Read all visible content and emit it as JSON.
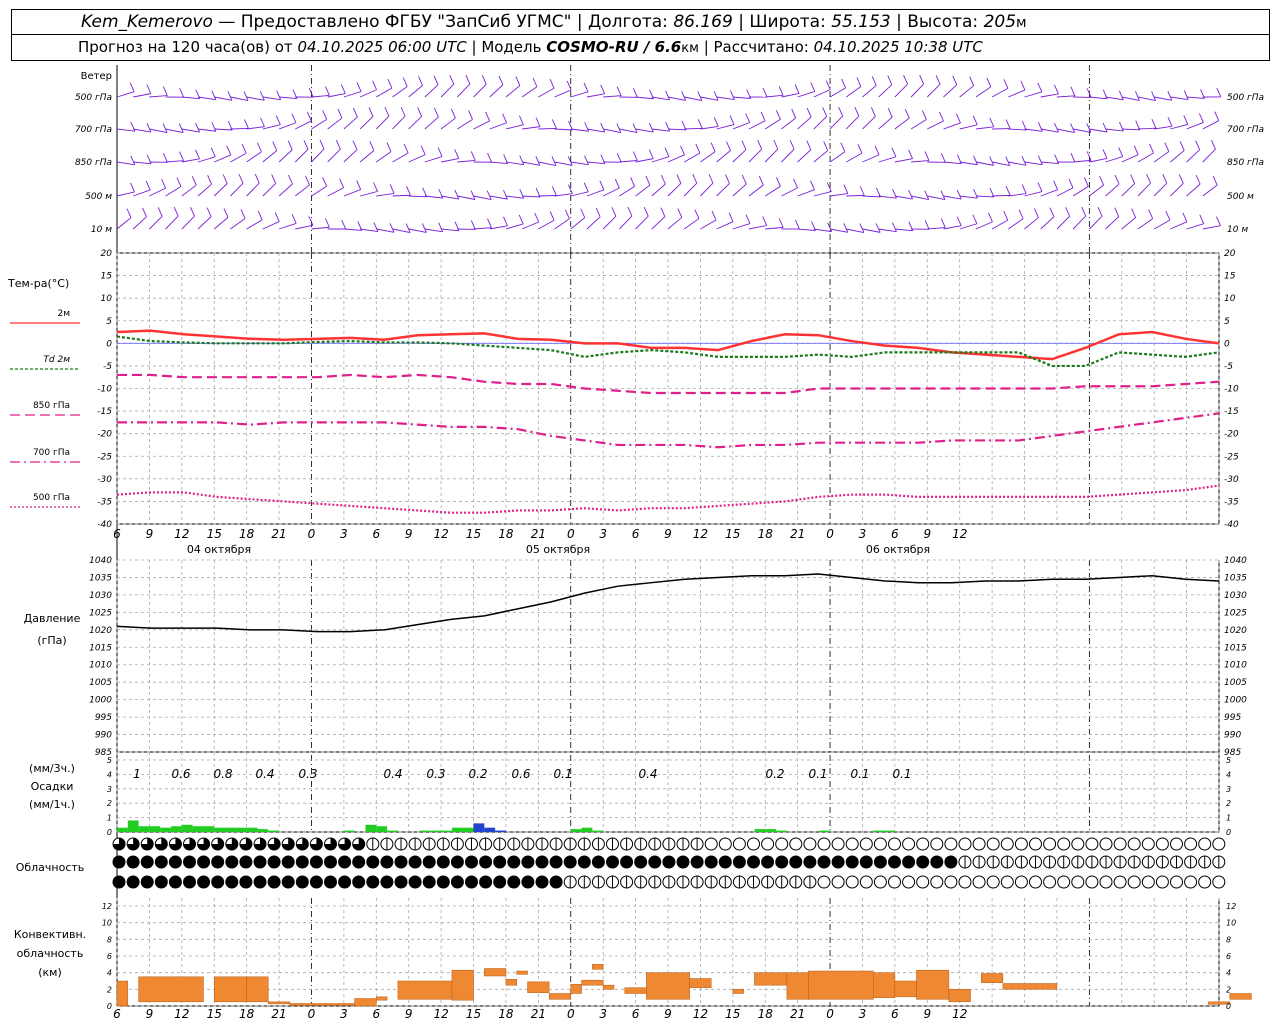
{
  "header": {
    "station": "Kem_Kemerovo",
    "dash": "—",
    "provider": "Предоставлено ФГБУ \"ЗапСиб УГМС\"",
    "lon_label": "Долгота:",
    "lon_value": "86.169",
    "lat_label": "Широта:",
    "lat_value": "55.153",
    "alt_label": "Высота:",
    "alt_value": "205",
    "alt_unit": "м",
    "forecast_label": "Прогноз на 120 часа(ов)  от",
    "start_time": "04.10.2025 06:00 UTC",
    "model_label": "Модель",
    "model_name": "COSMO-RU / 6.6",
    "model_unit": "км",
    "computed_label": "Рассчитано:",
    "computed_time": "04.10.2025 10:38 UTC"
  },
  "wind_panel": {
    "title": "Ветер",
    "levels": [
      "500 гПа",
      "700 гПа",
      "850 гПа",
      "500 м",
      "10  м"
    ]
  },
  "temp_panel": {
    "title": "Тем-ра(°C)",
    "legend": [
      "2м",
      "Td  2м",
      "850 гПа",
      "700 гПа",
      "500 гПа"
    ],
    "yticks": [
      20,
      15,
      10,
      5,
      0,
      -5,
      -10,
      -15,
      -20,
      -25,
      -30,
      -35,
      -40
    ]
  },
  "pressure_panel": {
    "title": "Давление",
    "unit": "(гПа)",
    "yticks": [
      1040,
      1035,
      1030,
      1025,
      1020,
      1015,
      1010,
      1005,
      1000,
      995,
      990,
      985
    ]
  },
  "precip_panel": {
    "unit3h": "(мм/3ч.)",
    "title": "Осадки",
    "unit1h": "(мм/1ч.)",
    "yticks": [
      5,
      4,
      3,
      2,
      1,
      0
    ],
    "labels": [
      "1",
      "0.6",
      "0.8",
      "0.4",
      "0.3",
      "0.4",
      "0.3",
      "0.2",
      "0.6",
      "0.1",
      "0.4",
      "0.2",
      "0.1",
      "0.1",
      "0.1"
    ]
  },
  "cloud_panel": {
    "title": "Облачность"
  },
  "conv_panel": {
    "title1": "Конвективн.",
    "title2": "облачность",
    "unit": "(км)",
    "yticks": [
      12,
      10,
      8,
      6,
      4,
      2,
      0
    ]
  },
  "time_axis": {
    "hours": [
      "6",
      "9",
      "12",
      "15",
      "18",
      "21",
      "0",
      "3",
      "6",
      "9",
      "12",
      "15",
      "18",
      "21",
      "0",
      "3",
      "6",
      "9",
      "12",
      "15",
      "18",
      "21",
      "0",
      "3",
      "6",
      "9",
      "12"
    ],
    "dates": [
      "04 октября",
      "05 октября",
      "06 октября"
    ]
  },
  "colors": {
    "wind": "#7a1fd8",
    "t2m": "#ff3333",
    "td2m": "#1a7a1a",
    "t850": "#e0208a",
    "t700": "#e0208a",
    "t500": "#e0208a",
    "pressure": "#000000",
    "precip_rain": "#22cc22",
    "precip_heavy": "#2244cc",
    "convective": "#ee8833"
  },
  "chart_data": {
    "type": "line",
    "x_hours_from_start": [
      0,
      3,
      6,
      9,
      12,
      15,
      18,
      21,
      24,
      27,
      30,
      33,
      36,
      39,
      42,
      45,
      48,
      51,
      54,
      57,
      60,
      63,
      66,
      69,
      72,
      75,
      78
    ],
    "temperature": {
      "ylim": [
        -40,
        20
      ],
      "series": [
        {
          "name": "2м",
          "values": [
            2.5,
            2.8,
            2,
            1.5,
            1,
            0.8,
            1,
            1.2,
            0.8,
            1.8,
            2,
            2.2,
            1,
            0.8,
            0,
            0,
            -1,
            -1,
            -1.5,
            0.5,
            2,
            1.8,
            0.5,
            -0.5,
            -1,
            -2,
            -2.5,
            -3,
            -3.5,
            -1,
            2,
            2.5,
            1,
            0
          ]
        },
        {
          "name": "Td  2м",
          "values": [
            1.5,
            0.5,
            0.2,
            0,
            0,
            0,
            0.3,
            0.5,
            0.2,
            0.2,
            0,
            -0.5,
            -1,
            -1.5,
            -3,
            -2,
            -1.5,
            -2,
            -3,
            -3,
            -3,
            -2.5,
            -3,
            -2,
            -2,
            -2,
            -2,
            -2,
            -5,
            -5,
            -2,
            -2.5,
            -3,
            -2
          ]
        },
        {
          "name": "850 гПа",
          "values": [
            -7,
            -7,
            -7.5,
            -7.5,
            -7.5,
            -7.5,
            -7.5,
            -7,
            -7.5,
            -7,
            -7.5,
            -8.5,
            -9,
            -9,
            -10,
            -10.5,
            -11,
            -11,
            -11,
            -11,
            -11,
            -10,
            -10,
            -10,
            -10,
            -10,
            -10,
            -10,
            -10,
            -9.5,
            -9.5,
            -9.5,
            -9,
            -8.5
          ]
        },
        {
          "name": "700 гПа",
          "values": [
            -17.5,
            -17.5,
            -17.5,
            -17.5,
            -18,
            -17.5,
            -17.5,
            -17.5,
            -17.5,
            -18,
            -18.5,
            -18.5,
            -19,
            -20.5,
            -21.5,
            -22.5,
            -22.5,
            -22.5,
            -23,
            -22.5,
            -22.5,
            -22,
            -22,
            -22,
            -22,
            -21.5,
            -21.5,
            -21.5,
            -20.5,
            -19.5,
            -18.5,
            -17.5,
            -16.5,
            -15.5
          ]
        },
        {
          "name": "500 гПа",
          "values": [
            -33.5,
            -33,
            -33,
            -34,
            -34.5,
            -35,
            -35.5,
            -36,
            -36.5,
            -37,
            -37.5,
            -37.5,
            -37,
            -37,
            -36.5,
            -37,
            -36.5,
            -36.5,
            -36,
            -35.5,
            -35,
            -34,
            -33.5,
            -33.5,
            -34,
            -34,
            -34,
            -34,
            -34,
            -34,
            -33.5,
            -33,
            -32.5,
            -31.5
          ]
        }
      ]
    },
    "pressure": {
      "ylim": [
        985,
        1040
      ],
      "values": [
        1021,
        1020.5,
        1020.5,
        1020.5,
        1020,
        1020,
        1019.5,
        1019.5,
        1020,
        1021.5,
        1023,
        1024,
        1026,
        1028,
        1030.5,
        1032.5,
        1033.5,
        1034.5,
        1035,
        1035.5,
        1035.5,
        1036,
        1035,
        1034,
        1033.5,
        1033.5,
        1034,
        1034,
        1034.5,
        1034.5,
        1035,
        1035.5,
        1034.5,
        1034
      ]
    },
    "precipitation": {
      "ylim": [
        0,
        5
      ],
      "hourly_mm": [
        0.3,
        0.8,
        0.4,
        0.4,
        0.3,
        0.4,
        0.5,
        0.4,
        0.4,
        0.3,
        0.3,
        0.3,
        0.3,
        0.2,
        0.1,
        0,
        0,
        0,
        0,
        0,
        0,
        0.1,
        0,
        0.5,
        0.4,
        0.1,
        0,
        0,
        0.1,
        0.1,
        0.1,
        0.3,
        0.3,
        0.6,
        0.3,
        0.1,
        0,
        0,
        0,
        0,
        0,
        0,
        0.2,
        0.3,
        0.1,
        0,
        0,
        0,
        0,
        0,
        0,
        0,
        0,
        0,
        0,
        0,
        0,
        0,
        0,
        0.2,
        0.2,
        0.1,
        0,
        0,
        0,
        0.1,
        0,
        0,
        0,
        0,
        0.1,
        0.1,
        0,
        0,
        0,
        0,
        0,
        0,
        0,
        0,
        0,
        0,
        0,
        0,
        0,
        0,
        0,
        0,
        0,
        0,
        0,
        0,
        0,
        0,
        0,
        0,
        0,
        0,
        0,
        0,
        0,
        0,
        0,
        0,
        0,
        0,
        0,
        0,
        0,
        0,
        0,
        0,
        0,
        0,
        0,
        0,
        0,
        0
      ],
      "three_hour_mm": [
        1,
        0.6,
        0.8,
        0.4,
        0.3,
        0.4,
        0.3,
        0.2,
        0.6,
        0.1,
        0.4,
        0.2,
        0.1,
        0.1,
        0.1
      ]
    },
    "convective_cloud_km": {
      "ylim": [
        0,
        12
      ],
      "segments_hours": [
        [
          0,
          1,
          3
        ],
        [
          2,
          8,
          0.5,
          3.5
        ],
        [
          9,
          12,
          0.5,
          3.5
        ],
        [
          12,
          14,
          0.5,
          3.5
        ],
        [
          14,
          16,
          0.3,
          0.5
        ],
        [
          16,
          22,
          0.2,
          0.3
        ],
        [
          22,
          24,
          0,
          0.9
        ],
        [
          24,
          25,
          0.7,
          1.1
        ],
        [
          26,
          31,
          0.8,
          3
        ],
        [
          31,
          33,
          0.7,
          4.3
        ],
        [
          34,
          36,
          3.6,
          4.5
        ],
        [
          36,
          37,
          2.5,
          3.2
        ],
        [
          37,
          38,
          3.8,
          4.2
        ],
        [
          38,
          40,
          1.6,
          2.9
        ],
        [
          40,
          42,
          0.8,
          1.5
        ],
        [
          42,
          43,
          1.5,
          2.6
        ],
        [
          43,
          45,
          2.5,
          3.1
        ],
        [
          44,
          45,
          4.4,
          5
        ],
        [
          45,
          46,
          2,
          2.5
        ],
        [
          47,
          49,
          1.5,
          2.2
        ],
        [
          49,
          53,
          0.8,
          4
        ],
        [
          53,
          55,
          2.2,
          3.3
        ],
        [
          57,
          58,
          1.5,
          2
        ],
        [
          59,
          62,
          2.5,
          4
        ],
        [
          62,
          64,
          0.8,
          4
        ],
        [
          64,
          70,
          0.8,
          4.2
        ],
        [
          70,
          72,
          1,
          4
        ],
        [
          72,
          74,
          1.1,
          3
        ],
        [
          74,
          77,
          0.8,
          4.3
        ],
        [
          77,
          79,
          0.5,
          2
        ],
        [
          80,
          82,
          2.8,
          3.9
        ],
        [
          82,
          87,
          2,
          2.7
        ],
        [
          101,
          103,
          0.2,
          0.5
        ],
        [
          103,
          105,
          0.8,
          1.5
        ]
      ]
    },
    "cloud_cover_rows": [
      "high",
      "middle",
      "low"
    ]
  }
}
